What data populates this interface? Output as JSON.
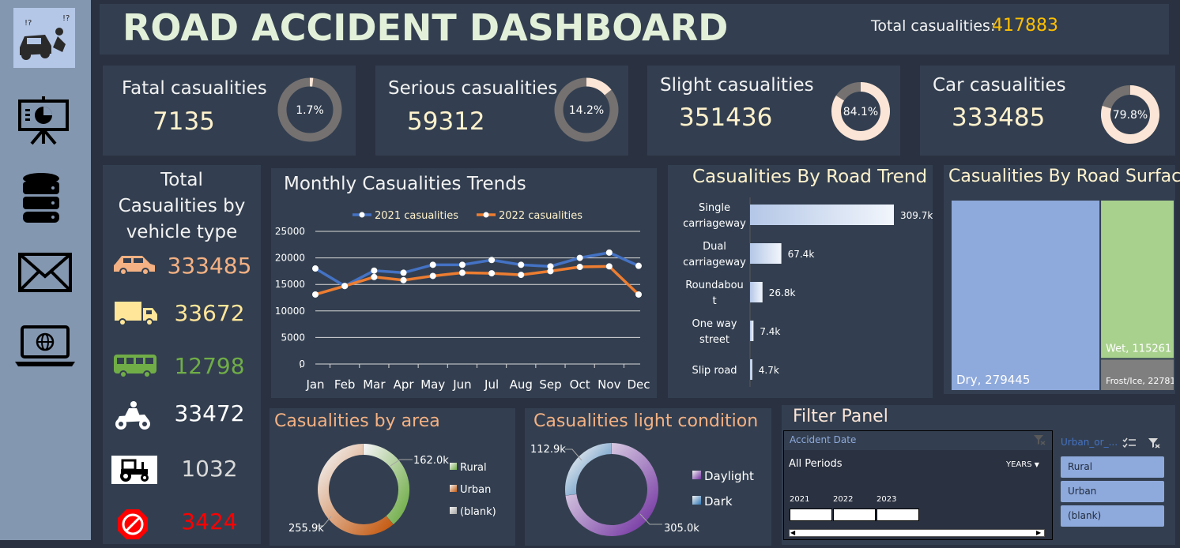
{
  "header": {
    "title": "ROAD ACCIDENT DASHBOARD",
    "total_label": "Total casualities:",
    "total_value": "417883"
  },
  "sidebar": {
    "icons": [
      "accident-logo-icon",
      "presentation-chart-icon",
      "database-icon",
      "mail-icon",
      "laptop-globe-icon"
    ]
  },
  "kpis": [
    {
      "title": "Fatal casualities",
      "value": "7135",
      "pct_label": "1.7%",
      "pct": 1.7,
      "track": "#757171",
      "fill": "#fbe5d6"
    },
    {
      "title": "Serious casualities",
      "value": "59312",
      "pct_label": "14.2%",
      "pct": 14.2,
      "track": "#757171",
      "fill": "#fbe5d6"
    },
    {
      "title": "Slight casualities",
      "value": "351436",
      "pct_label": "84.1%",
      "pct": 84.1,
      "track": "#757171",
      "fill": "#fbe5d6"
    },
    {
      "title": "Car casualities",
      "value": "333485",
      "pct_label": "79.8%",
      "pct": 79.8,
      "track": "#757171",
      "fill": "#fbe5d6"
    }
  ],
  "vehicle": {
    "title": "Total Casualities by vehicle type",
    "items": [
      {
        "icon": "car-icon",
        "value": "333485",
        "color": "#f4b183"
      },
      {
        "icon": "truck-icon",
        "value": "33672",
        "color": "#ffe699"
      },
      {
        "icon": "bus-icon",
        "value": "12798",
        "color": "#70ad47"
      },
      {
        "icon": "motorcycle-icon",
        "value": "33472",
        "color": "#ffffff"
      },
      {
        "icon": "tractor-icon",
        "value": "1032",
        "color": "#d9d9d9"
      },
      {
        "icon": "no-entry-icon",
        "value": "3424",
        "color": "#ff0000"
      }
    ]
  },
  "chart_data": [
    {
      "type": "line",
      "title": "Monthly Casualities Trends",
      "categories": [
        "Jan",
        "Feb",
        "Mar",
        "Apr",
        "May",
        "Jun",
        "Jul",
        "Aug",
        "Sep",
        "Oct",
        "Nov",
        "Dec"
      ],
      "series": [
        {
          "name": "2021 casualities",
          "color": "#4472c4",
          "values": [
            18000,
            14700,
            17600,
            17200,
            18700,
            18700,
            19600,
            18700,
            18400,
            20000,
            21000,
            18500
          ]
        },
        {
          "name": "2022 casualities",
          "color": "#ed7d31",
          "values": [
            13100,
            14700,
            16400,
            15800,
            16600,
            17200,
            17100,
            16800,
            17500,
            18300,
            18400,
            13100
          ]
        }
      ],
      "ylim": [
        0,
        25000
      ],
      "yticks": [
        "0",
        "5000",
        "10000",
        "15000",
        "20000",
        "25000"
      ],
      "grid": true,
      "legend": "top"
    },
    {
      "type": "bar",
      "title": "Casualities By Road Trend",
      "categories": [
        "Single carriageway",
        "Dual carriageway",
        "Roundabout",
        "One way street",
        "Slip road"
      ],
      "category_lines": [
        [
          "Single",
          "carriageway"
        ],
        [
          "Dual",
          "carriageway"
        ],
        [
          "Roundabou",
          "t"
        ],
        [
          "One way",
          "street"
        ],
        [
          "Slip road"
        ]
      ],
      "values": [
        309.7,
        67.4,
        26.8,
        7.4,
        4.7
      ],
      "labels": [
        "309.7k",
        "67.4k",
        "26.8k",
        "7.4k",
        "4.7k"
      ],
      "color": "#dae3f3"
    },
    {
      "type": "treemap",
      "title": "Casualities By Road Surface",
      "items": [
        {
          "name": "Dry",
          "value": 279445,
          "label": "Dry, 279445",
          "color": "#8ea9db"
        },
        {
          "name": "Wet",
          "value": 115261,
          "label": "Wet, 115261",
          "color": "#a9d18e"
        },
        {
          "name": "Frost/Ice",
          "value": 22781,
          "label": "Frost/Ice, 22781",
          "color": "#7f7f7f"
        }
      ]
    },
    {
      "type": "pie",
      "title": "Casualities by area",
      "slices": [
        {
          "name": "Rural",
          "value": 162.0,
          "label": "162.0k",
          "color": "#70ad47"
        },
        {
          "name": "Urban",
          "value": 255.9,
          "label": "255.9k",
          "color": "#c55a11"
        },
        {
          "name": "(blank)",
          "value": 0,
          "label": "",
          "color": "#a5a5a5"
        }
      ],
      "legend": "right"
    },
    {
      "type": "pie",
      "title": "Casualities light condition",
      "slices": [
        {
          "name": "Daylight",
          "value": 305.0,
          "label": "305.0k",
          "color": "#7030a0"
        },
        {
          "name": "Dark",
          "value": 112.9,
          "label": "112.9k",
          "color": "#2e75b6"
        }
      ],
      "legend": "right"
    }
  ],
  "filter": {
    "title": "Filter Panel",
    "date_header": "Accident Date",
    "period": "All Periods",
    "years_label": "YEARS",
    "years": [
      "2021",
      "2022",
      "2023"
    ],
    "urban_header": "Urban_or_...",
    "urban_options": [
      "Rural",
      "Urban",
      "(blank)"
    ]
  }
}
